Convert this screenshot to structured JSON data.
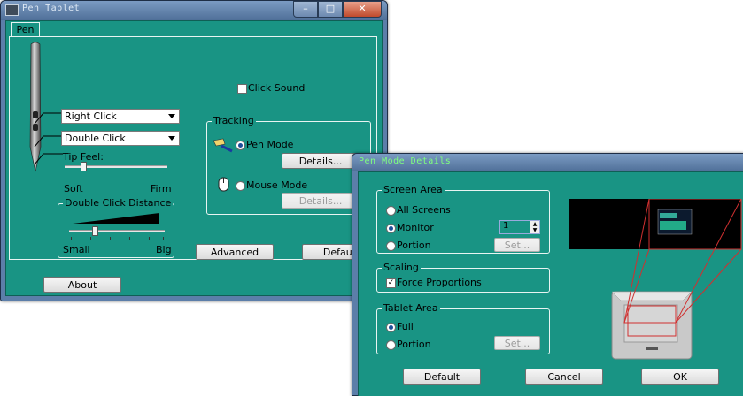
{
  "colors": {
    "client_bg": "#199484",
    "title_bar": "#5c7ea9",
    "accent_title_text": "#7fff7f"
  },
  "pen_window": {
    "title": "Pen Tablet",
    "tab": "Pen",
    "button_combo_1": "Right Click",
    "button_combo_2": "Double Click",
    "tip_feel_label": "Tip Feel:",
    "tip_soft": "Soft",
    "tip_firm": "Firm",
    "tip_feel_level": 0.25,
    "dcd_label": "Double Click Distance",
    "dcd_small": "Small",
    "dcd_big": "Big",
    "dcd_level": 0.3,
    "click_sound": "Click Sound",
    "tracking_label": "Tracking",
    "pen_mode": "Pen Mode",
    "pen_details": "Details...",
    "mouse_mode": "Mouse Mode",
    "mouse_details": "Details...",
    "advanced": "Advanced",
    "default": "Default",
    "about": "About"
  },
  "mapping_window": {
    "title": "Pen Mode Details",
    "screen_area": "Screen Area",
    "all_screens": "All Screens",
    "monitor": "Monitor",
    "monitor_value": "1",
    "portion": "Portion",
    "set": "Set...",
    "scaling": "Scaling",
    "force_proportions": "Force Proportions",
    "tablet_area": "Tablet Area",
    "full": "Full",
    "tablet_portion": "Portion",
    "tablet_set": "Set...",
    "default_btn": "Default",
    "cancel_btn": "Cancel",
    "ok_btn": "OK"
  }
}
